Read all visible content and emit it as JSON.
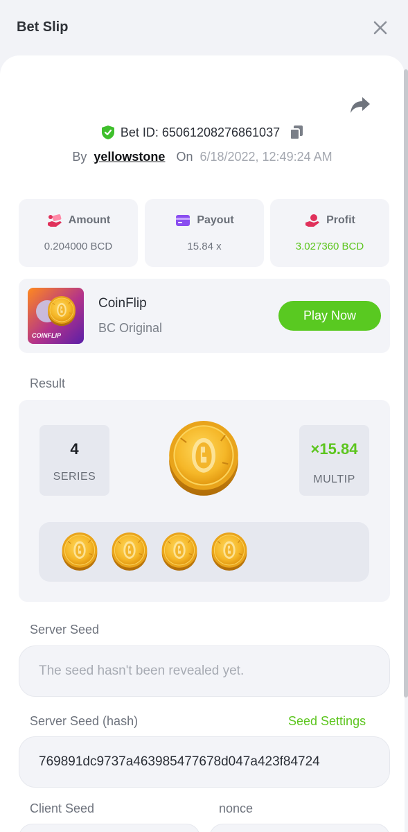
{
  "header": {
    "title": "Bet Slip"
  },
  "bet": {
    "id_label": "Bet ID: 65061208276861037",
    "by_label": "By",
    "username": "yellowstone",
    "on_label": "On",
    "datetime": "6/18/2022, 12:49:24 AM"
  },
  "stats": {
    "amount": {
      "label": "Amount",
      "value": "0.204000 BCD",
      "icon": "money-hand-icon"
    },
    "payout": {
      "label": "Payout",
      "value": "15.84 x",
      "icon": "card-icon"
    },
    "profit": {
      "label": "Profit",
      "value": "3.027360 BCD",
      "icon": "profit-hand-icon"
    }
  },
  "game": {
    "name": "CoinFlip",
    "subtitle": "BC Original",
    "thumb_text": "COINFLIP",
    "play_label": "Play Now"
  },
  "result": {
    "label": "Result",
    "series_value": "4",
    "series_label": "SERIES",
    "multiplier_value": "×15.84",
    "multiplier_label": "MULTIP",
    "coins_flipped": 4
  },
  "server_seed": {
    "label": "Server Seed",
    "placeholder": "The seed hasn't been revealed yet."
  },
  "server_seed_hash": {
    "label": "Server Seed (hash)",
    "settings_label": "Seed Settings",
    "value": "769891dc9737a463985477678d047a423f84724"
  },
  "client_seed": {
    "label": "Client Seed"
  },
  "nonce": {
    "label": "nonce"
  },
  "colors": {
    "accent_green": "#59c921",
    "profit_green": "#5cc51e",
    "background": "#f2f3f7",
    "card": "#ffffff",
    "coin_gold": "#f4b72a"
  }
}
